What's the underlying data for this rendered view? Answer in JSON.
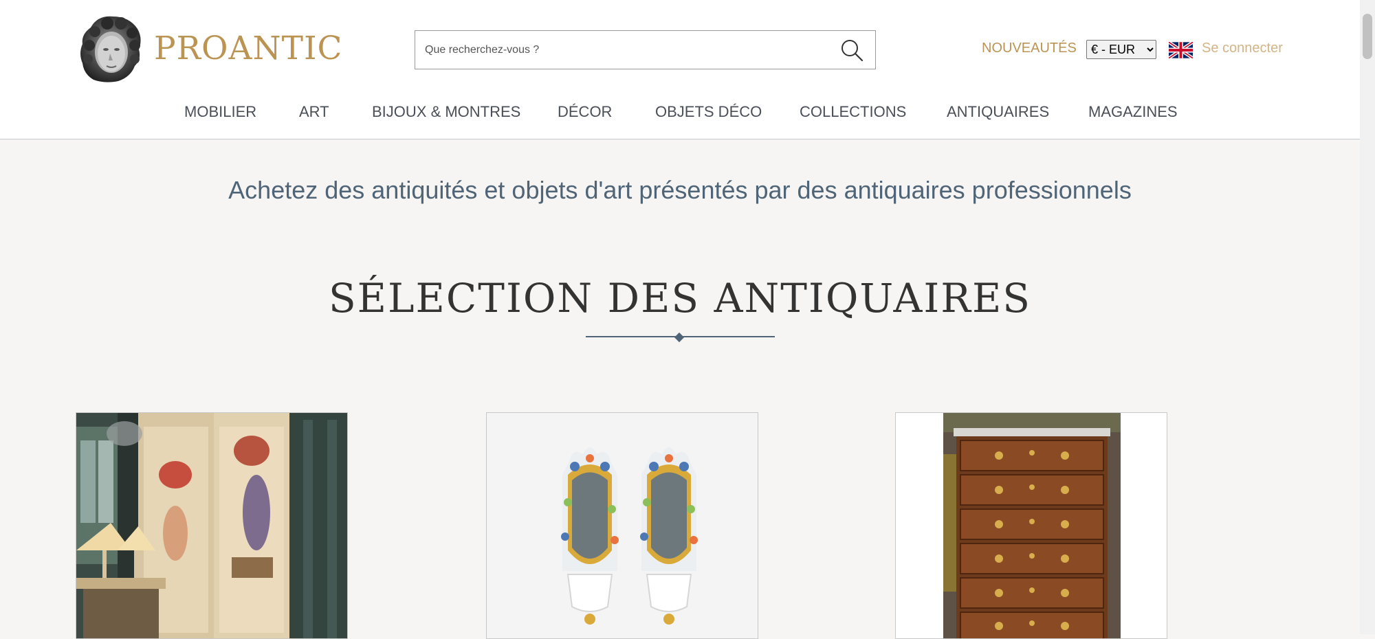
{
  "header": {
    "logo_text": "PROANTIC",
    "search": {
      "placeholder": "Que recherchez-vous ?",
      "value": ""
    },
    "nouveautes_label": "NOUVEAUTÉS",
    "currency": {
      "selected": "€ - EUR"
    },
    "language_flag": "uk-flag-icon",
    "login_label": "Se connecter"
  },
  "nav": {
    "items": [
      {
        "label": "MOBILIER"
      },
      {
        "label": "ART"
      },
      {
        "label": "BIJOUX & MONTRES"
      },
      {
        "label": "DÉCOR"
      },
      {
        "label": "OBJETS DÉCO"
      },
      {
        "label": "COLLECTIONS"
      },
      {
        "label": "ANTIQUAIRES"
      },
      {
        "label": "MAGAZINES"
      }
    ]
  },
  "hero": {
    "tagline": "Achetez des antiquités et objets d'art présentés par des antiquaires professionnels"
  },
  "selection": {
    "title": "SÉLECTION DES ANTIQUAIRES",
    "products": [
      {
        "image": "painted-panels-photo"
      },
      {
        "image": "porcelain-mirror-sconces-photo"
      },
      {
        "image": "chest-of-drawers-photo"
      }
    ]
  },
  "colors": {
    "brand_gold": "#bb9453",
    "login_gold": "#d2b486",
    "tagline_blue": "#4f6476",
    "page_bg": "#f6f5f3"
  }
}
